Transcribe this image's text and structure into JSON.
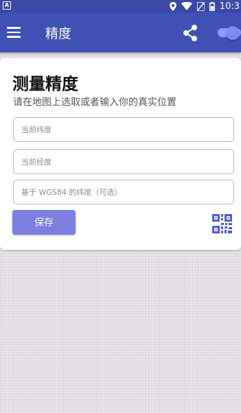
{
  "status_bar": {
    "time": "10:3",
    "icon_names": [
      "notification-a-icon",
      "location-icon",
      "wifi-icon",
      "no-sim-icon",
      "battery-icon"
    ]
  },
  "app_bar": {
    "title": "精度",
    "icon_names": [
      "menu-icon",
      "share-icon",
      "toggle-switch"
    ]
  },
  "card": {
    "title": "测量精度",
    "subtitle": "请在地图上选取或者输入你的真实位置",
    "fields": [
      {
        "placeholder": "当前纬度",
        "value": ""
      },
      {
        "placeholder": "当前经度",
        "value": ""
      },
      {
        "placeholder": "基于 WGS84 的纬度（可选）",
        "value": ""
      }
    ],
    "save_label": "保存",
    "qr_icon": "qr-code-icon"
  },
  "colors": {
    "status_bar": "#3a4aa5",
    "app_bar": "#3f51b5",
    "button": "#7b7fe0",
    "toggle": "#8c9eff",
    "background": "#e9e4ea"
  }
}
